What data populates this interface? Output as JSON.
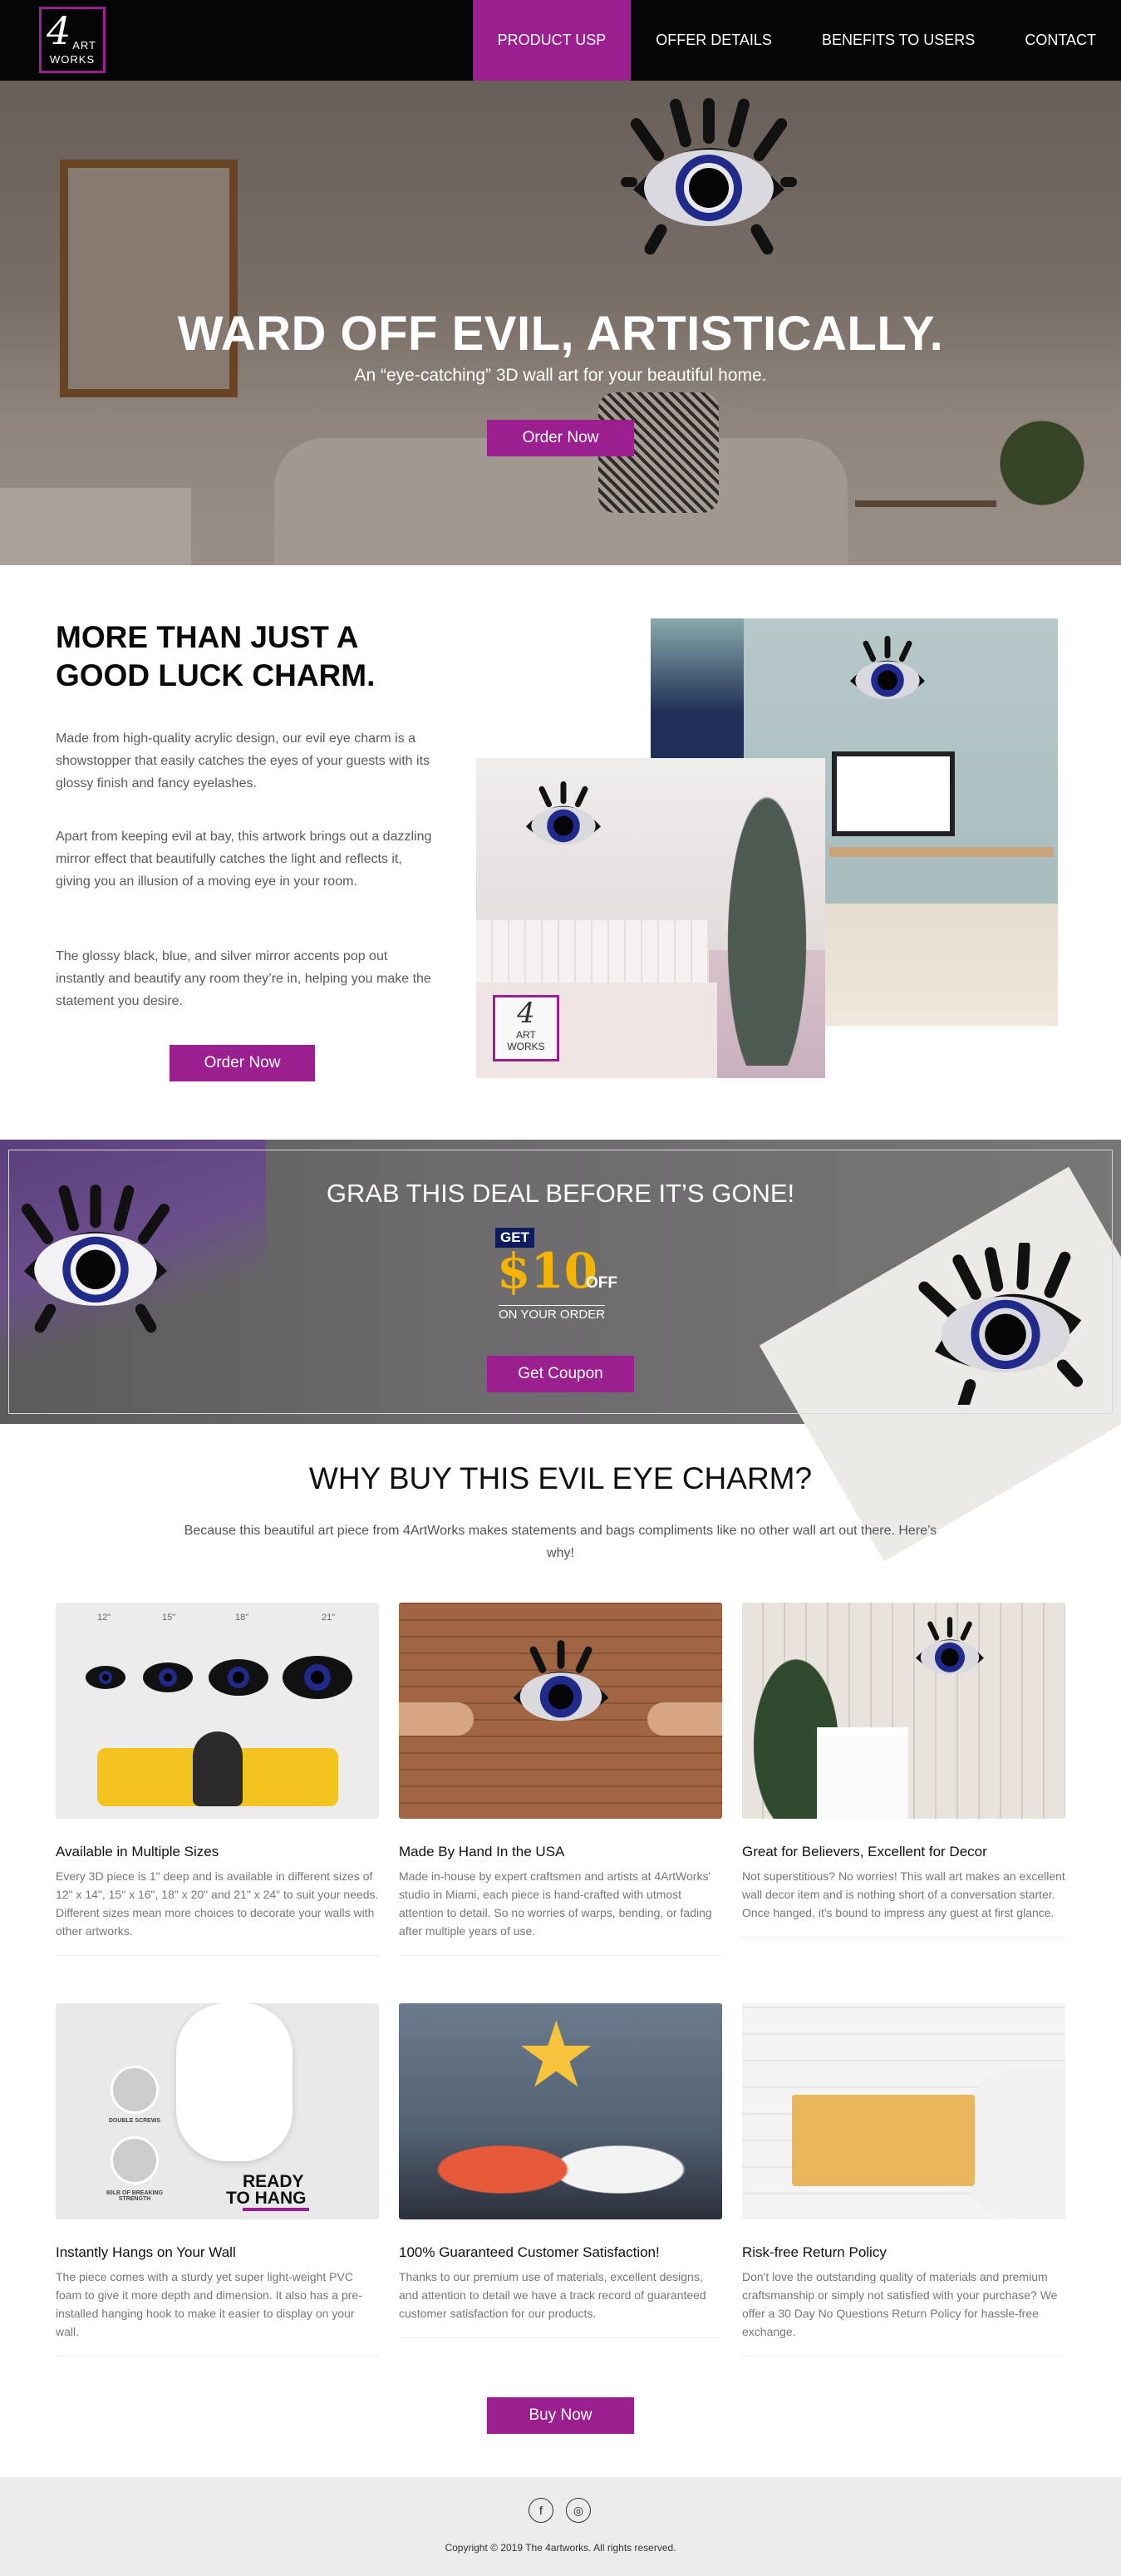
{
  "nav": {
    "logo": {
      "number": "4",
      "line1": "ART",
      "line2": "WORKS"
    },
    "items": [
      {
        "label": "PRODUCT USP",
        "active": true
      },
      {
        "label": "OFFER DETAILS",
        "active": false
      },
      {
        "label": "BENEFITS TO USERS",
        "active": false
      },
      {
        "label": "CONTACT",
        "active": false
      }
    ]
  },
  "hero": {
    "title": "WARD OFF EVIL, ARTISTICALLY.",
    "subtitle": "An “eye-catching” 3D wall art for your beautiful home.",
    "button": "Order Now"
  },
  "charm": {
    "title": "MORE THAN JUST A GOOD LUCK CHARM.",
    "paragraphs": [
      "Made from high-quality acrylic design, our evil eye charm is a showstopper that easily catches the eyes of your guests with its glossy finish and fancy eyelashes.",
      "Apart from keeping evil at bay, this artwork brings out a dazzling mirror effect that beautifully catches the light and reflects it, giving you an illusion of a moving eye in your room.",
      "The glossy black, blue, and silver mirror accents pop out instantly and beautify any room they’re in, helping you make the statement you desire."
    ],
    "button": "Order Now",
    "photo_logo": {
      "number": "4",
      "line1": "ART",
      "line2": "WORKS"
    }
  },
  "deal": {
    "title": "GRAB THIS DEAL BEFORE IT’S GONE!",
    "get": "GET",
    "amount": "$10",
    "off": "OFF",
    "on_order": "ON YOUR ORDER",
    "button": "Get Coupon"
  },
  "why": {
    "title": "WHY BUY THIS EVIL EYE CHARM?",
    "intro": "Because this beautiful art piece from 4ArtWorks makes statements and bags compliments like no other wall art out there. Here’s why!",
    "sizes": [
      "12\"",
      "15\"",
      "18\"",
      "21\""
    ],
    "ready_line1": "READY",
    "ready_line2": "TO HANG",
    "double_screws": "DOUBLE SCREWS",
    "breaking_strength": "80LB OF BREAKING STRENGTH",
    "cards": [
      {
        "title": "Available in Multiple Sizes",
        "text": "Every 3D piece is 1\" deep and is available in different sizes of 12\" x 14\", 15\" x 16\", 18\" x 20\" and 21\" x 24\" to suit your needs. Different sizes mean more choices to decorate your walls with other artworks."
      },
      {
        "title": "Made By Hand In the USA",
        "text": "Made in-house by expert craftsmen and artists at 4ArtWorks' studio in Miami, each piece is hand-crafted with utmost attention to detail. So no worries of warps, bending, or fading after multiple years of use."
      },
      {
        "title": "Great for Believers, Excellent for Decor",
        "text": "Not superstitious? No worries! This wall art makes an excellent wall decor item and is nothing short of a conversation starter. Once hanged, it's bound to impress any guest at first glance."
      },
      {
        "title": "Instantly Hangs on Your Wall",
        "text": "The piece comes with a sturdy yet super light-weight PVC foam to give it more depth and dimension. It also has a pre-installed hanging hook to make it easier to display on your wall."
      },
      {
        "title": "100% Guaranteed Customer Satisfaction!",
        "text": "Thanks to our premium use of materials, excellent designs, and attention to detail we have a track record of guaranteed customer satisfaction for our products."
      },
      {
        "title": "Risk-free Return Policy",
        "text": "Don't love the outstanding quality of materials and premium craftsmanship or simply not satisfied with your purchase? We offer a 30 Day No Questions Return Policy for hassle-free exchange."
      }
    ],
    "button": "Buy Now"
  },
  "footer": {
    "social": [
      {
        "icon": "facebook-icon",
        "glyph": "f"
      },
      {
        "icon": "instagram-icon",
        "glyph": "◎"
      }
    ],
    "copyright": "Copyright © 2019 The 4artworks. All rights reserved."
  },
  "colors": {
    "accent": "#9c1f8f",
    "nav_bg": "#050505",
    "eye_blue": "#1f2a8a"
  }
}
